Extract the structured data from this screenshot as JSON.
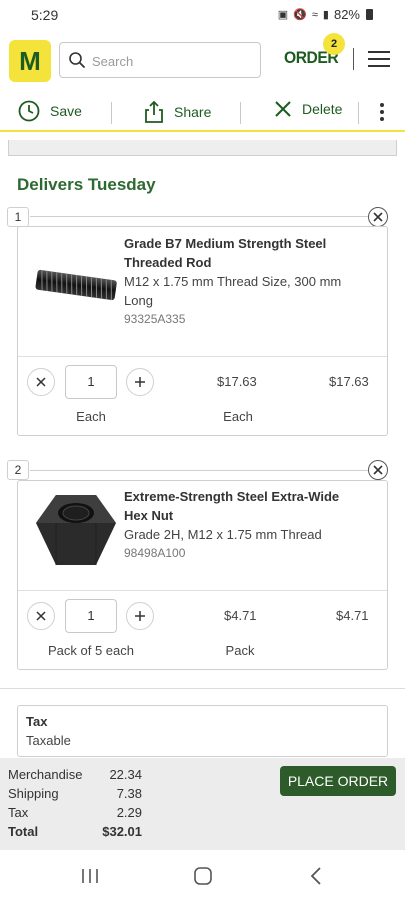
{
  "status_bar": {
    "time": "5:29",
    "battery": "82%"
  },
  "header": {
    "logo": "M",
    "search_placeholder": "Search",
    "order_label": "ORDER",
    "order_count": "2"
  },
  "actions": {
    "save": "Save",
    "share": "Share",
    "delete": "Delete"
  },
  "delivery": {
    "heading": "Delivers Tuesday"
  },
  "items": [
    {
      "number": "1",
      "title_line1": "Grade B7 Medium Strength Steel",
      "title_line2": "Threaded Rod",
      "desc_line1": "M12 x 1.75 mm Thread Size, 300 mm",
      "desc_line2": "Long",
      "part": "93325A335",
      "quantity": "1",
      "unit_price": "$17.63",
      "total": "$17.63",
      "qty_unit": "Each",
      "price_unit": "Each"
    },
    {
      "number": "2",
      "title_line1": "Extreme-Strength Steel Extra-Wide",
      "title_line2": "Hex Nut",
      "desc_line1": "Grade 2H, M12 x 1.75 mm Thread",
      "desc_line2": "",
      "part": "98498A100",
      "quantity": "1",
      "unit_price": "$4.71",
      "total": "$4.71",
      "qty_unit": "Pack of 5 each",
      "price_unit": "Pack"
    }
  ],
  "tax_box": {
    "label": "Tax",
    "value": "Taxable"
  },
  "summary": {
    "merchandise_label": "Merchandise",
    "merchandise": "22.34",
    "shipping_label": "Shipping",
    "shipping": "7.38",
    "tax_label": "Tax",
    "tax": "2.29",
    "total_label": "Total",
    "total": "$32.01",
    "place_order": "PLACE ORDER"
  },
  "colors": {
    "brand_yellow": "#f4e33b",
    "brand_green": "#1e5b20",
    "button_green": "#2d5b2a"
  }
}
